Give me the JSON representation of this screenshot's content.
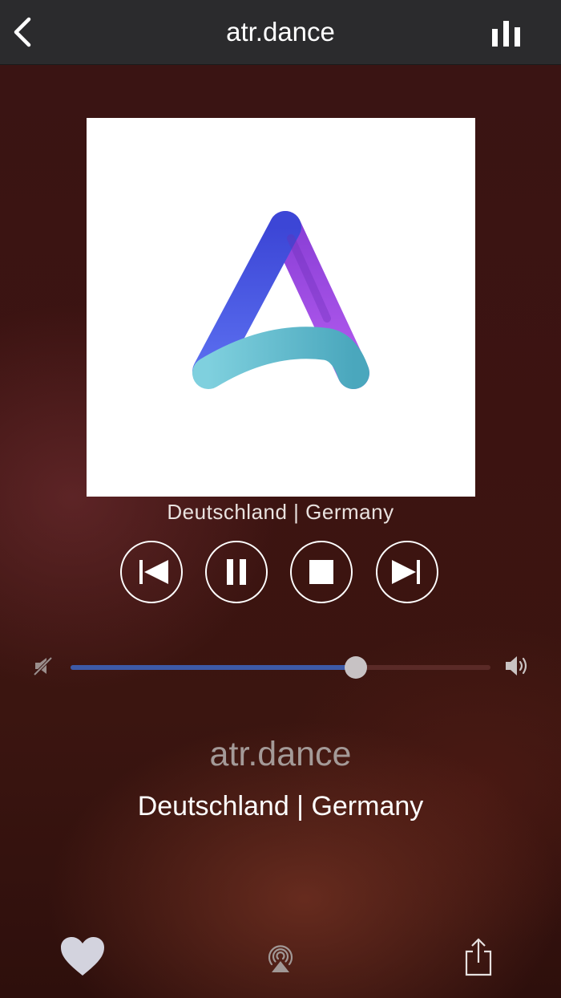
{
  "header": {
    "title": "atr.dance",
    "back_icon": "chevron-left-icon",
    "equalizer_icon": "equalizer-bars-icon"
  },
  "artwork": {
    "logo": "atr-dance-logo",
    "colors": {
      "blue": "#4a55e0",
      "purple": "#a04be0",
      "teal": "#6cc4d4"
    }
  },
  "station": {
    "subtitle_small": "Deutschland | Germany",
    "name": "atr.dance",
    "subtitle": "Deutschland | Germany"
  },
  "controls": [
    {
      "name": "previous",
      "icon": "skip-previous-icon"
    },
    {
      "name": "pause",
      "icon": "pause-icon"
    },
    {
      "name": "stop",
      "icon": "stop-icon"
    },
    {
      "name": "next",
      "icon": "skip-next-icon"
    }
  ],
  "volume": {
    "level": 0.68,
    "fill_color": "#3d5aa8"
  },
  "toolbar": {
    "favorite_icon": "heart-icon",
    "airplay_icon": "airplay-icon",
    "share_icon": "share-icon"
  }
}
